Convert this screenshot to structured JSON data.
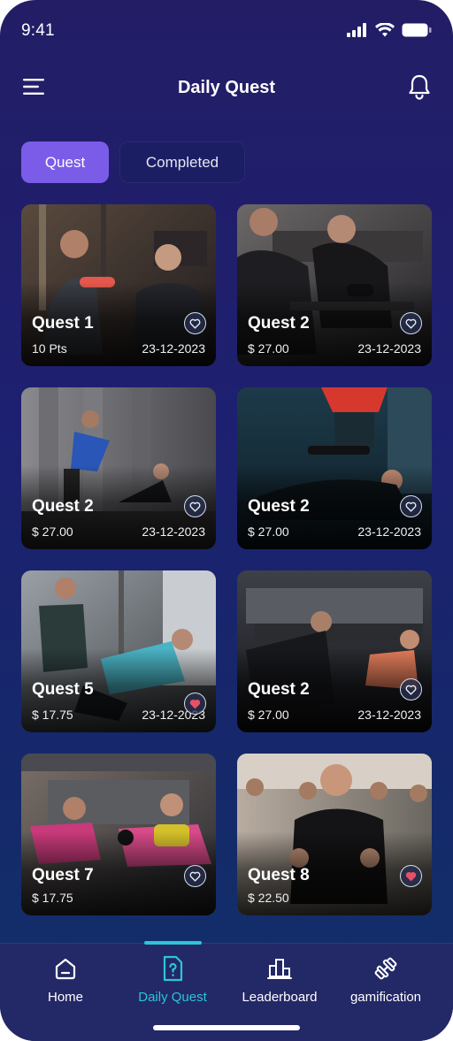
{
  "status_bar": {
    "time": "9:41"
  },
  "header": {
    "title": "Daily Quest"
  },
  "tabs": [
    {
      "label": "Quest",
      "active": true
    },
    {
      "label": "Completed",
      "active": false
    }
  ],
  "quests": [
    {
      "title": "Quest 1",
      "sub": "10 Pts",
      "date": "23-12-2023",
      "favorite": false
    },
    {
      "title": "Quest 2",
      "sub": "$ 27.00",
      "date": "23-12-2023",
      "favorite": false
    },
    {
      "title": "Quest 2",
      "sub": "$ 27.00",
      "date": "23-12-2023",
      "favorite": false
    },
    {
      "title": "Quest 2",
      "sub": "$ 27.00",
      "date": "23-12-2023",
      "favorite": false
    },
    {
      "title": "Quest 5",
      "sub": "$ 17.75",
      "date": "23-12-2023",
      "favorite": true
    },
    {
      "title": "Quest 2",
      "sub": "$ 27.00",
      "date": "23-12-2023",
      "favorite": false
    },
    {
      "title": "Quest 7",
      "sub": "$ 17.75",
      "date": "",
      "favorite": false
    },
    {
      "title": "Quest 8",
      "sub": "$ 22.50",
      "date": "",
      "favorite": true
    }
  ],
  "bottom_nav": [
    {
      "label": "Home",
      "icon": "home-icon",
      "active": false
    },
    {
      "label": "Daily Quest",
      "icon": "quest-icon",
      "active": true
    },
    {
      "label": "Leaderboard",
      "icon": "leaderboard-icon",
      "active": false
    },
    {
      "label": "gamification",
      "icon": "dumbbell-icon",
      "active": false
    }
  ],
  "colors": {
    "accent": "#7b5ce8",
    "active_nav": "#2bc5d9",
    "favorite": "#e8506a"
  }
}
